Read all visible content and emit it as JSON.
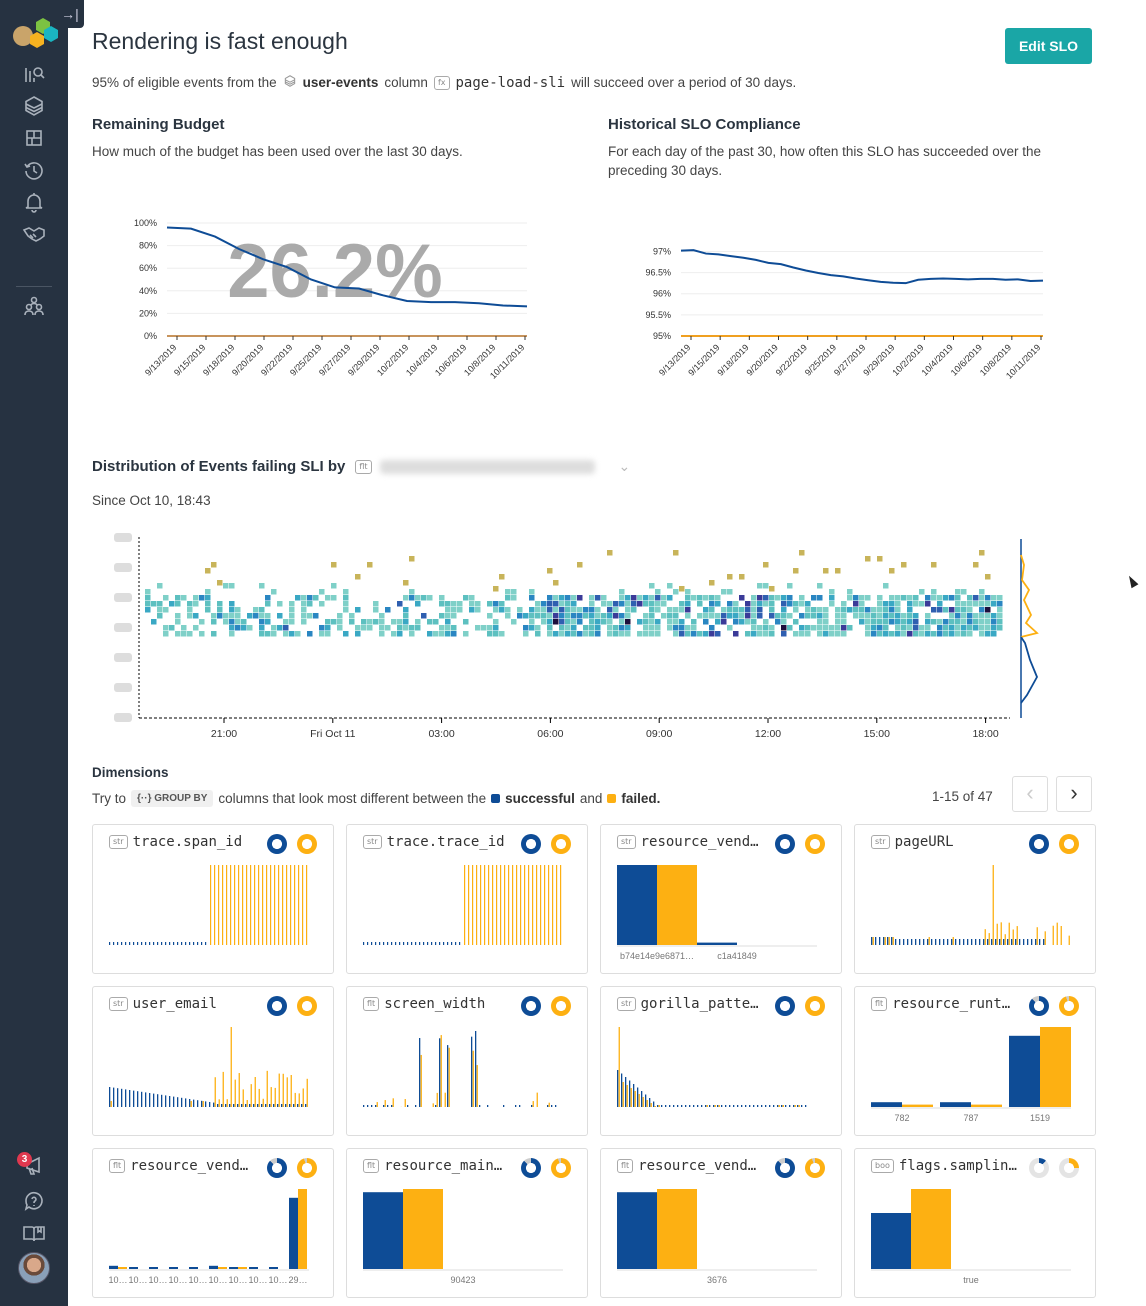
{
  "sidebar": {
    "collapse_icon": "→|",
    "nav": [
      {
        "name": "query-icon"
      },
      {
        "name": "datasets-icon"
      },
      {
        "name": "boards-icon"
      },
      {
        "name": "history-icon"
      },
      {
        "name": "triggers-icon"
      },
      {
        "name": "slo-icon"
      },
      {
        "name": "team-icon"
      }
    ],
    "notifications_count": "3"
  },
  "header": {
    "title": "Rendering is fast enough",
    "edit_button": "Edit SLO",
    "sub_prefix": "95% of eligible events from the",
    "dataset": "user-events",
    "sub_column": "column",
    "fx_tag": "fx",
    "sli": "page-load-sli",
    "sub_suffix": "will succeed over a period of 30 days."
  },
  "budget": {
    "title": "Remaining Budget",
    "desc": "How much of the budget has been used over the last 30 days.",
    "big_value": "26.2%"
  },
  "compliance": {
    "title": "Historical SLO Compliance",
    "desc1": "For each day of the past 30, how often this SLO has succeeded over the",
    "desc2": "preceding 30 days."
  },
  "chart_data": [
    {
      "type": "line",
      "title": "Remaining Budget",
      "x": [
        "9/13/2019",
        "9/15/2019",
        "9/18/2019",
        "9/20/2019",
        "9/22/2019",
        "9/25/2019",
        "9/27/2019",
        "9/29/2019",
        "10/2/2019",
        "10/4/2019",
        "10/6/2019",
        "10/8/2019",
        "10/11/2019"
      ],
      "yticks": [
        "0%",
        "20%",
        "40%",
        "60%",
        "80%",
        "100%"
      ],
      "ylim": [
        0,
        100
      ],
      "series": [
        {
          "name": "budget",
          "color": "#0e4c96",
          "values": [
            96,
            95,
            88,
            77,
            68,
            61,
            50,
            43,
            42,
            36,
            31,
            30,
            30,
            29,
            27,
            26.2
          ]
        },
        {
          "name": "threshold",
          "color": "#c8945c",
          "values": [
            0,
            0
          ]
        }
      ]
    },
    {
      "type": "line",
      "title": "Historical SLO Compliance",
      "x": [
        "9/13/2019",
        "9/15/2019",
        "9/18/2019",
        "9/20/2019",
        "9/22/2019",
        "9/25/2019",
        "9/27/2019",
        "9/29/2019",
        "10/2/2019",
        "10/4/2019",
        "10/6/2019",
        "10/8/2019",
        "10/11/2019"
      ],
      "yticks": [
        "95%",
        "95.5%",
        "96%",
        "96.5%",
        "97%"
      ],
      "ylim": [
        95,
        97.2
      ],
      "series": [
        {
          "name": "compliance",
          "color": "#0e4c96",
          "values": [
            97.02,
            97.03,
            96.95,
            96.93,
            96.89,
            96.85,
            96.8,
            96.73,
            96.7,
            96.62,
            96.55,
            96.49,
            96.44,
            96.41,
            96.36,
            96.32,
            96.28,
            96.26,
            96.25,
            96.33,
            96.35,
            96.36,
            96.35,
            96.34,
            96.35,
            96.35,
            96.33,
            96.34,
            96.3,
            96.31
          ]
        },
        {
          "name": "target",
          "color": "#f0a020",
          "values": [
            95,
            95
          ]
        }
      ]
    },
    {
      "type": "heatmap",
      "title": "Distribution of Events failing SLI by",
      "x_ticks": [
        "21:00",
        "Fri Oct 11",
        "03:00",
        "06:00",
        "09:00",
        "12:00",
        "15:00",
        "18:00"
      ]
    }
  ],
  "distribution": {
    "title": "Distribution of Events failing SLI by",
    "tag": "flt",
    "since": "Since Oct 10, 18:43"
  },
  "dimensions": {
    "title": "Dimensions",
    "try_to": "Try to",
    "group_by": "GROUP BY",
    "middle": "columns that look most different between the",
    "successful": "successful",
    "and": "and",
    "failed": "failed.",
    "pager": "1-15 of 47",
    "colors": {
      "successful": "#0e4c96",
      "failed": "#fdb012"
    },
    "cards": [
      {
        "type": "str",
        "name": "trace.span_id",
        "kind": "ticks",
        "labels": []
      },
      {
        "type": "str",
        "name": "trace.trace_id",
        "kind": "ticks",
        "labels": []
      },
      {
        "type": "str",
        "name": "resource_vend…",
        "kind": "bars",
        "labels": [
          "b74e14e9e6871…",
          "c1a41849"
        ],
        "s": [
          1,
          0.03
        ],
        "f": [
          1,
          0
        ]
      },
      {
        "type": "str",
        "name": "pageURL",
        "kind": "spikes",
        "labels": []
      },
      {
        "type": "str",
        "name": "user_email",
        "kind": "spikes2",
        "labels": []
      },
      {
        "type": "flt",
        "name": "screen_width",
        "kind": "spikes3",
        "labels": []
      },
      {
        "type": "str",
        "name": "gorilla_patte…",
        "kind": "spikes4",
        "labels": []
      },
      {
        "type": "flt",
        "name": "resource_runt…",
        "kind": "bars",
        "labels": [
          "782",
          "787",
          "1519"
        ],
        "s": [
          0.06,
          0.06,
          0.89
        ],
        "f": [
          0.03,
          0.03,
          1
        ]
      },
      {
        "type": "flt",
        "name": "resource_vend…",
        "kind": "bars",
        "labels": [
          "10…",
          "10…",
          "10…",
          "10…",
          "10…",
          "10…",
          "10…",
          "10…",
          "10…",
          "29…"
        ],
        "s": [
          0.04,
          0.02,
          0.02,
          0.02,
          0.02,
          0.04,
          0.02,
          0.02,
          0.02,
          0.89
        ],
        "f": [
          0.02,
          0,
          0,
          0,
          0,
          0.02,
          0.02,
          0,
          0,
          1
        ]
      },
      {
        "type": "flt",
        "name": "resource_main…",
        "kind": "bars",
        "labels": [
          "90423"
        ],
        "s": [
          0.96
        ],
        "f": [
          1
        ]
      },
      {
        "type": "flt",
        "name": "resource_vend…",
        "kind": "bars",
        "labels": [
          "3676"
        ],
        "s": [
          0.96
        ],
        "f": [
          1
        ]
      },
      {
        "type": "boo",
        "name": "flags.samplin…",
        "kind": "bars",
        "labels": [
          "true"
        ],
        "s": [
          0.7
        ],
        "f": [
          1
        ]
      }
    ]
  }
}
